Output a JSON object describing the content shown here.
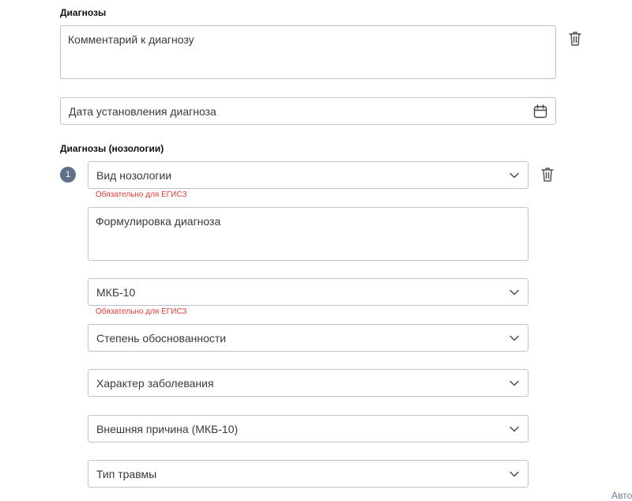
{
  "diagnoses": {
    "title": "Диагнозы",
    "comment_placeholder": "Комментарий к диагнозу",
    "date_placeholder": "Дата установления диагноза"
  },
  "nosologies": {
    "title": "Диагнозы (нозологии)",
    "index": "1",
    "nosology_type": "Вид нозологии",
    "required_note": "Обязательно для ЕГИСЗ",
    "formulation_placeholder": "Формулировка диагноза",
    "icd10": "МКБ-10",
    "icd10_required_note": "Обязательно для ЕГИСЗ",
    "validity_degree": "Степень обоснованности",
    "disease_character": "Характер заболевания",
    "external_cause": "Внешняя причина (МКБ-10)",
    "injury_type": "Тип травмы"
  },
  "corner": {
    "text": "Авто"
  },
  "icons": {
    "trash": "trash-icon",
    "calendar": "calendar-icon",
    "chevron": "chevron-down-icon"
  }
}
